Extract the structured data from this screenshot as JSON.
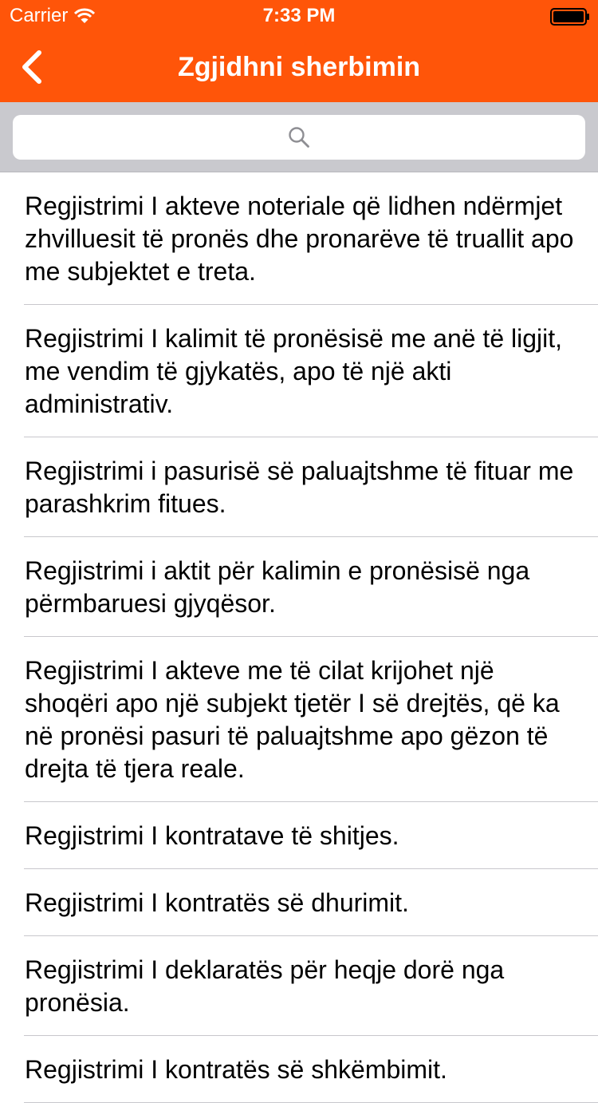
{
  "status_bar": {
    "carrier": "Carrier",
    "time": "7:33 PM"
  },
  "nav": {
    "title": "Zgjidhni sherbimin",
    "back_icon": "chevron-left-icon"
  },
  "search": {
    "placeholder": "",
    "icon": "search-icon"
  },
  "colors": {
    "header_bg": "#ff5509",
    "search_bar_bg": "#c9c9ce",
    "separator": "#c8c7cc"
  },
  "services": [
    {
      "label": "Regjistrimi I akteve noteriale që lidhen ndërmjet zhvilluesit të pronës dhe pronarëve të truallit apo me subjektet e treta."
    },
    {
      "label": "Regjistrimi I kalimit të pronësisë me anë të ligjit, me vendim të gjykatës, apo të një akti administrativ."
    },
    {
      "label": "Regjistrimi i pasurisë së paluajtshme të fituar me parashkrim fitues."
    },
    {
      "label": "Regjistrimi i aktit për kalimin e pronësisë nga përmbaruesi gjyqësor."
    },
    {
      "label": "Regjistrimi I akteve me të cilat krijohet një shoqëri apo një subjekt tjetër I së drejtës, që ka në pronësi pasuri të paluajtshme apo gëzon të drejta të tjera reale."
    },
    {
      "label": "Regjistrimi I kontratave të shitjes."
    },
    {
      "label": "Regjistrimi I kontratës së dhurimit."
    },
    {
      "label": "Regjistrimi I deklaratës për heqje dorë nga pronësia."
    },
    {
      "label": "Regjistrimi I kontratës së shkëmbimit."
    }
  ]
}
